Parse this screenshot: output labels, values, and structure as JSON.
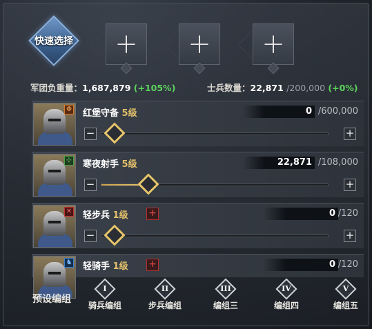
{
  "quick_select": {
    "label": "快速选择"
  },
  "slots": [
    "+",
    "+",
    "+"
  ],
  "stats": {
    "load_label": "军团负重量：",
    "load_value": "1,687,879",
    "load_bonus": "(+105%)",
    "soldiers_label": "士兵数量：",
    "soldiers_value": "22,871",
    "soldiers_max": "/200,000",
    "soldiers_bonus": "(+0%)"
  },
  "units": [
    {
      "name": "红堡守备",
      "level": "5级",
      "count": "0",
      "max": "/600,000",
      "fill": 0.0,
      "has_slider": true,
      "has_add": false
    },
    {
      "name": "寒夜射手",
      "level": "5级",
      "count": "22,871",
      "max": "/108,000",
      "fill": 0.21,
      "has_slider": true,
      "has_add": false
    },
    {
      "name": "轻步兵",
      "level": "1级",
      "count": "0",
      "max": "/120",
      "fill": 0.0,
      "has_slider": true,
      "has_add": true
    },
    {
      "name": "轻骑手",
      "level": "1级",
      "count": "0",
      "max": "/120",
      "fill": 0.0,
      "has_slider": false,
      "has_add": true
    }
  ],
  "slider_buttons": {
    "minus": "−",
    "plus": "+"
  },
  "unit_icons": [
    "shield-type-icon",
    "bow-type-icon",
    "sword-type-icon",
    "horse-type-icon"
  ],
  "presets": {
    "label": "预设编组",
    "groups": [
      {
        "numeral": "I",
        "label": "骑兵编组"
      },
      {
        "numeral": "II",
        "label": "步兵编组"
      },
      {
        "numeral": "III",
        "label": "编组三"
      },
      {
        "numeral": "IV",
        "label": "编组四"
      },
      {
        "numeral": "V",
        "label": "编组五"
      }
    ]
  },
  "colors": {
    "accent_gold": "#e7c66b",
    "bonus_green": "#5dd35d",
    "alert_red": "#e24a4a",
    "quick_blue": "#5a82b4"
  }
}
